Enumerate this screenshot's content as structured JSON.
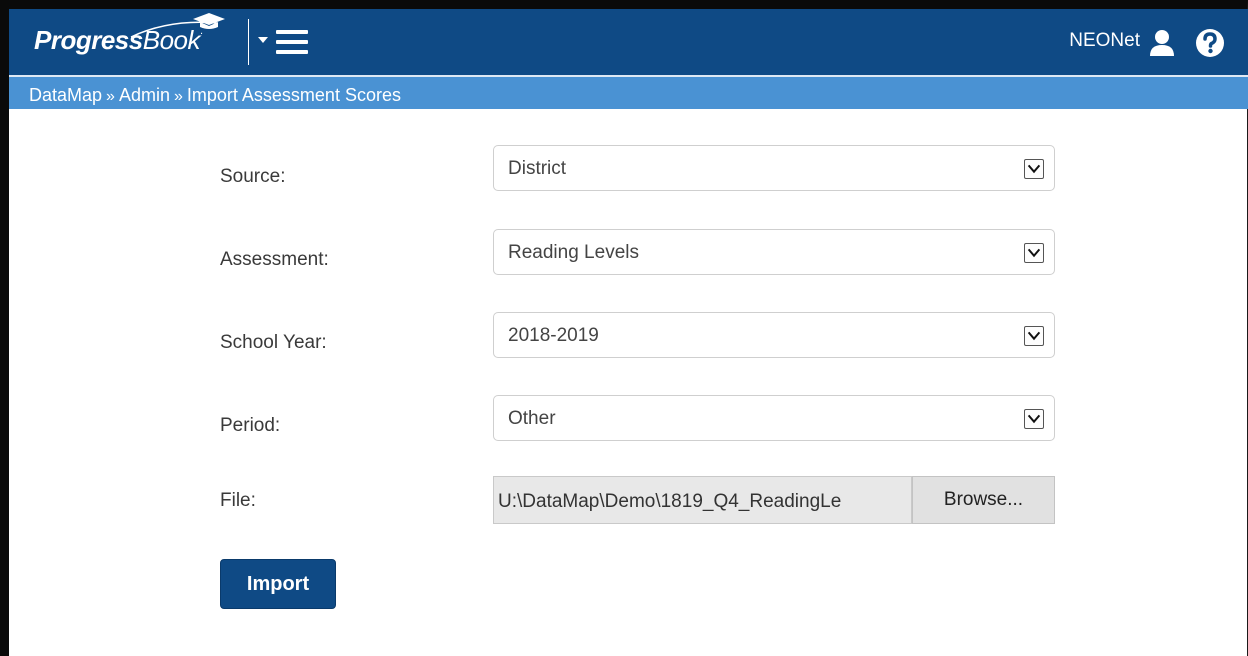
{
  "header": {
    "logo_bold": "Progress",
    "logo_light": "Book",
    "logo_tm": ".",
    "organization": "NEONet",
    "user_icon": "user-icon",
    "help_icon": "help-icon",
    "menu_icon": "hamburger-menu-icon",
    "brand_color": "#0f4a85"
  },
  "breadcrumb": {
    "items": [
      "DataMap",
      "Admin",
      "Import Assessment Scores"
    ],
    "separator": "»",
    "bar_color": "#4a92d3"
  },
  "form": {
    "source": {
      "label": "Source:",
      "value": "District"
    },
    "assessment": {
      "label": "Assessment:",
      "value": "Reading Levels"
    },
    "school_year": {
      "label": "School Year:",
      "value": "2018-2019"
    },
    "period": {
      "label": "Period:",
      "value": "Other"
    },
    "file": {
      "label": "File:",
      "value": "U:\\DataMap\\Demo\\1819_Q4_ReadingLe",
      "browse_label": "Browse..."
    },
    "import_label": "Import"
  }
}
